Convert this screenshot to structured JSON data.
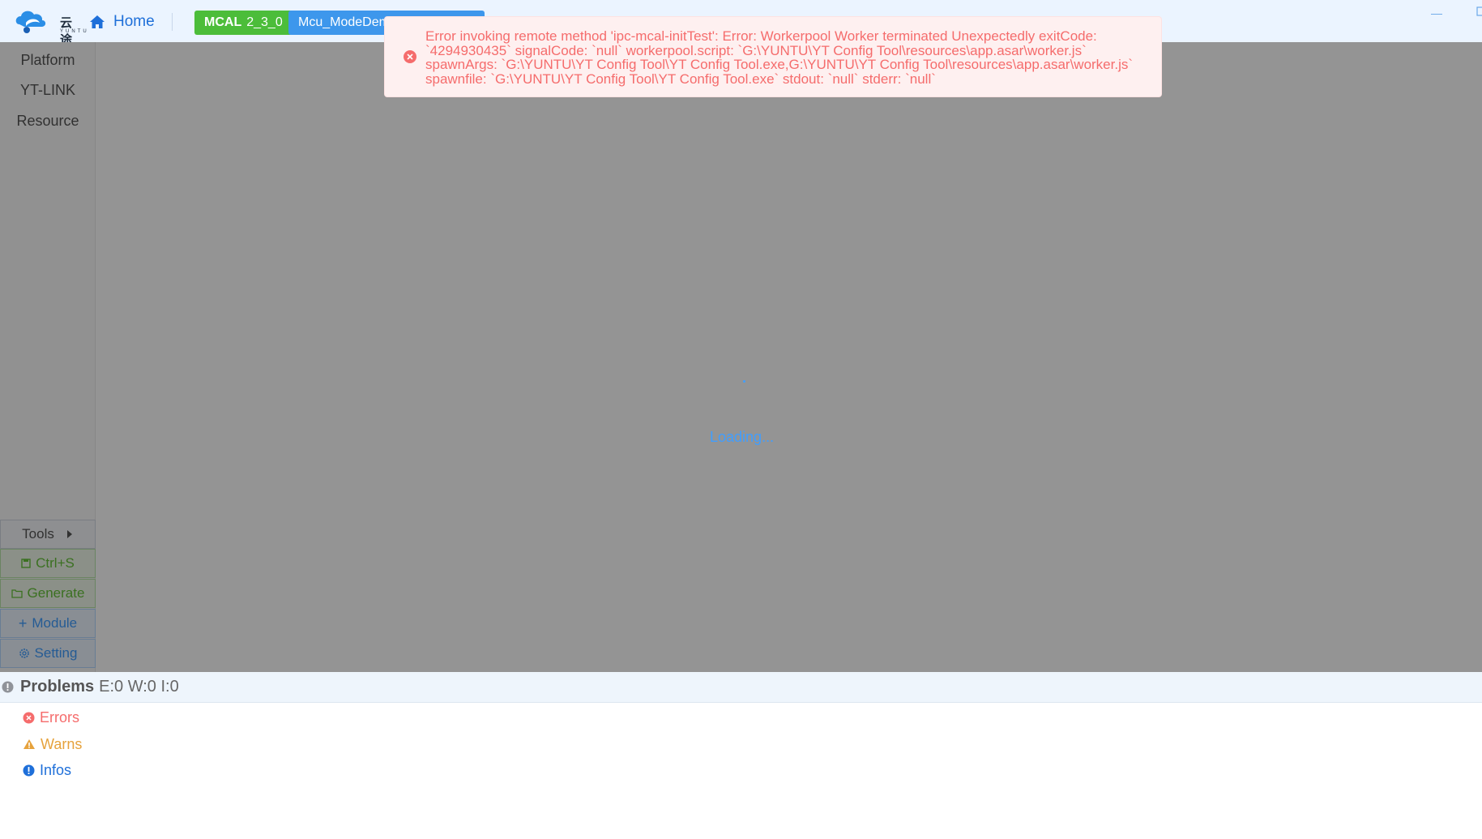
{
  "app": {
    "logo_text": "云途",
    "logo_subtext": "YUNTU"
  },
  "header": {
    "home_label": "Home",
    "mcal_tag_bold": "MCAL",
    "mcal_tag_version": "2_3_0",
    "project_tag": "Mcu_ModeDemo",
    "window_min": "—"
  },
  "sidebar": {
    "items": [
      {
        "label": "Platform"
      },
      {
        "label": "YT-LINK"
      },
      {
        "label": "Resource"
      }
    ],
    "buttons": {
      "tools": "Tools",
      "save": "Ctrl+S",
      "generate": "Generate",
      "module": "Module",
      "setting": "Setting"
    }
  },
  "main": {
    "loading_text": "Loading..."
  },
  "toast": {
    "type": "error",
    "lines": [
      "Error invoking remote method 'ipc-mcal-initTest': Error: Workerpool Worker terminated Unexpectedly exitCode:",
      "`4294930435` signalCode: `null` workerpool.script: `G:\\YUNTU\\YT Config Tool\\resources\\app.asar\\worker.js`",
      "spawnArgs: `G:\\YUNTU\\YT Config Tool\\YT Config Tool.exe,G:\\YUNTU\\YT Config Tool\\resources\\app.asar\\worker.js`",
      "spawnfile: `G:\\YUNTU\\YT Config Tool\\YT Config Tool.exe` stdout: `null` stderr: `null`"
    ]
  },
  "problems": {
    "title": "Problems",
    "counts": "E:0 W:0 I:0",
    "categories": [
      {
        "label": "Errors"
      },
      {
        "label": "Warns"
      },
      {
        "label": "Infos"
      }
    ]
  },
  "colors": {
    "accent": "#1e6fd9",
    "mcal_tag": "#4cbd3a",
    "project_tag": "#3d97ec",
    "error": "#f56c6c",
    "warning": "#e6a23c",
    "info": "#1e6fd9",
    "save_green": "#67c23a"
  },
  "icons": {
    "home": "home-icon",
    "error": "error-circle-icon",
    "warning": "warning-triangle-icon",
    "info": "info-circle-icon"
  }
}
